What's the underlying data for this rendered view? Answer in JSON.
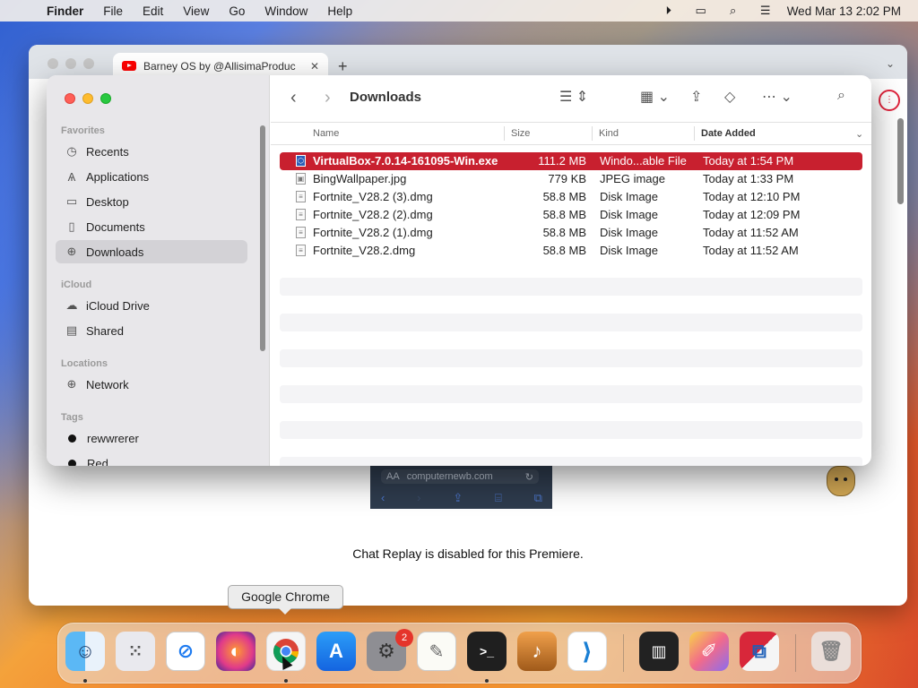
{
  "menubar": {
    "app_name": "Finder",
    "items": [
      "File",
      "Edit",
      "View",
      "Go",
      "Window",
      "Help"
    ],
    "clock": "Wed Mar 13  2:02 PM",
    "status_icons": [
      "screen-record-icon",
      "display-icon",
      "spotlight-icon",
      "control-center-icon"
    ]
  },
  "browser": {
    "tab_title": "Barney OS by @AllisimaProduc",
    "video_url": "computernewb.com",
    "video_text_size": "AA",
    "chat_message": "Chat Replay is disabled for this Premiere."
  },
  "finder": {
    "title": "Downloads",
    "sidebar": {
      "favorites_header": "Favorites",
      "favorites": [
        {
          "label": "Recents",
          "icon": "clock-icon"
        },
        {
          "label": "Applications",
          "icon": "applications-icon"
        },
        {
          "label": "Desktop",
          "icon": "desktop-icon"
        },
        {
          "label": "Documents",
          "icon": "document-icon"
        },
        {
          "label": "Downloads",
          "icon": "download-icon",
          "selected": true
        }
      ],
      "icloud_header": "iCloud",
      "icloud": [
        {
          "label": "iCloud Drive",
          "icon": "cloud-icon"
        },
        {
          "label": "Shared",
          "icon": "shared-folder-icon"
        }
      ],
      "locations_header": "Locations",
      "locations": [
        {
          "label": "Network",
          "icon": "globe-icon"
        }
      ],
      "tags_header": "Tags",
      "tags": [
        {
          "label": "rewwrerer",
          "color": "#111111"
        },
        {
          "label": "Red",
          "color": "#111111"
        }
      ]
    },
    "columns": {
      "name": "Name",
      "size": "Size",
      "kind": "Kind",
      "date": "Date Added"
    },
    "files": [
      {
        "name": "VirtualBox-7.0.14-161095-Win.exe",
        "size": "111.2 MB",
        "kind": "Windo...able File",
        "date": "Today at 1:54 PM",
        "selected": true
      },
      {
        "name": "BingWallpaper.jpg",
        "size": "779 KB",
        "kind": "JPEG image",
        "date": "Today at 1:33 PM"
      },
      {
        "name": "Fortnite_V28.2 (3).dmg",
        "size": "58.8 MB",
        "kind": "Disk Image",
        "date": "Today at 12:10 PM"
      },
      {
        "name": "Fortnite_V28.2 (2).dmg",
        "size": "58.8 MB",
        "kind": "Disk Image",
        "date": "Today at 12:09 PM"
      },
      {
        "name": "Fortnite_V28.2 (1).dmg",
        "size": "58.8 MB",
        "kind": "Disk Image",
        "date": "Today at 11:52 AM"
      },
      {
        "name": "Fortnite_V28.2.dmg",
        "size": "58.8 MB",
        "kind": "Disk Image",
        "date": "Today at 11:52 AM"
      }
    ]
  },
  "tooltip": "Google Chrome",
  "dock": {
    "system_settings_badge": "2",
    "apps": [
      "finder",
      "launchpad",
      "safari",
      "firefox",
      "google-chrome",
      "app-store",
      "system-settings",
      "textedit",
      "terminal",
      "garageband",
      "vscode",
      "piano",
      "pages",
      "parallels",
      "trash"
    ]
  },
  "colors": {
    "selection": "#c8202f",
    "sidebar_bg": "#e8e7ea",
    "dock_badge": "#e5342b"
  }
}
